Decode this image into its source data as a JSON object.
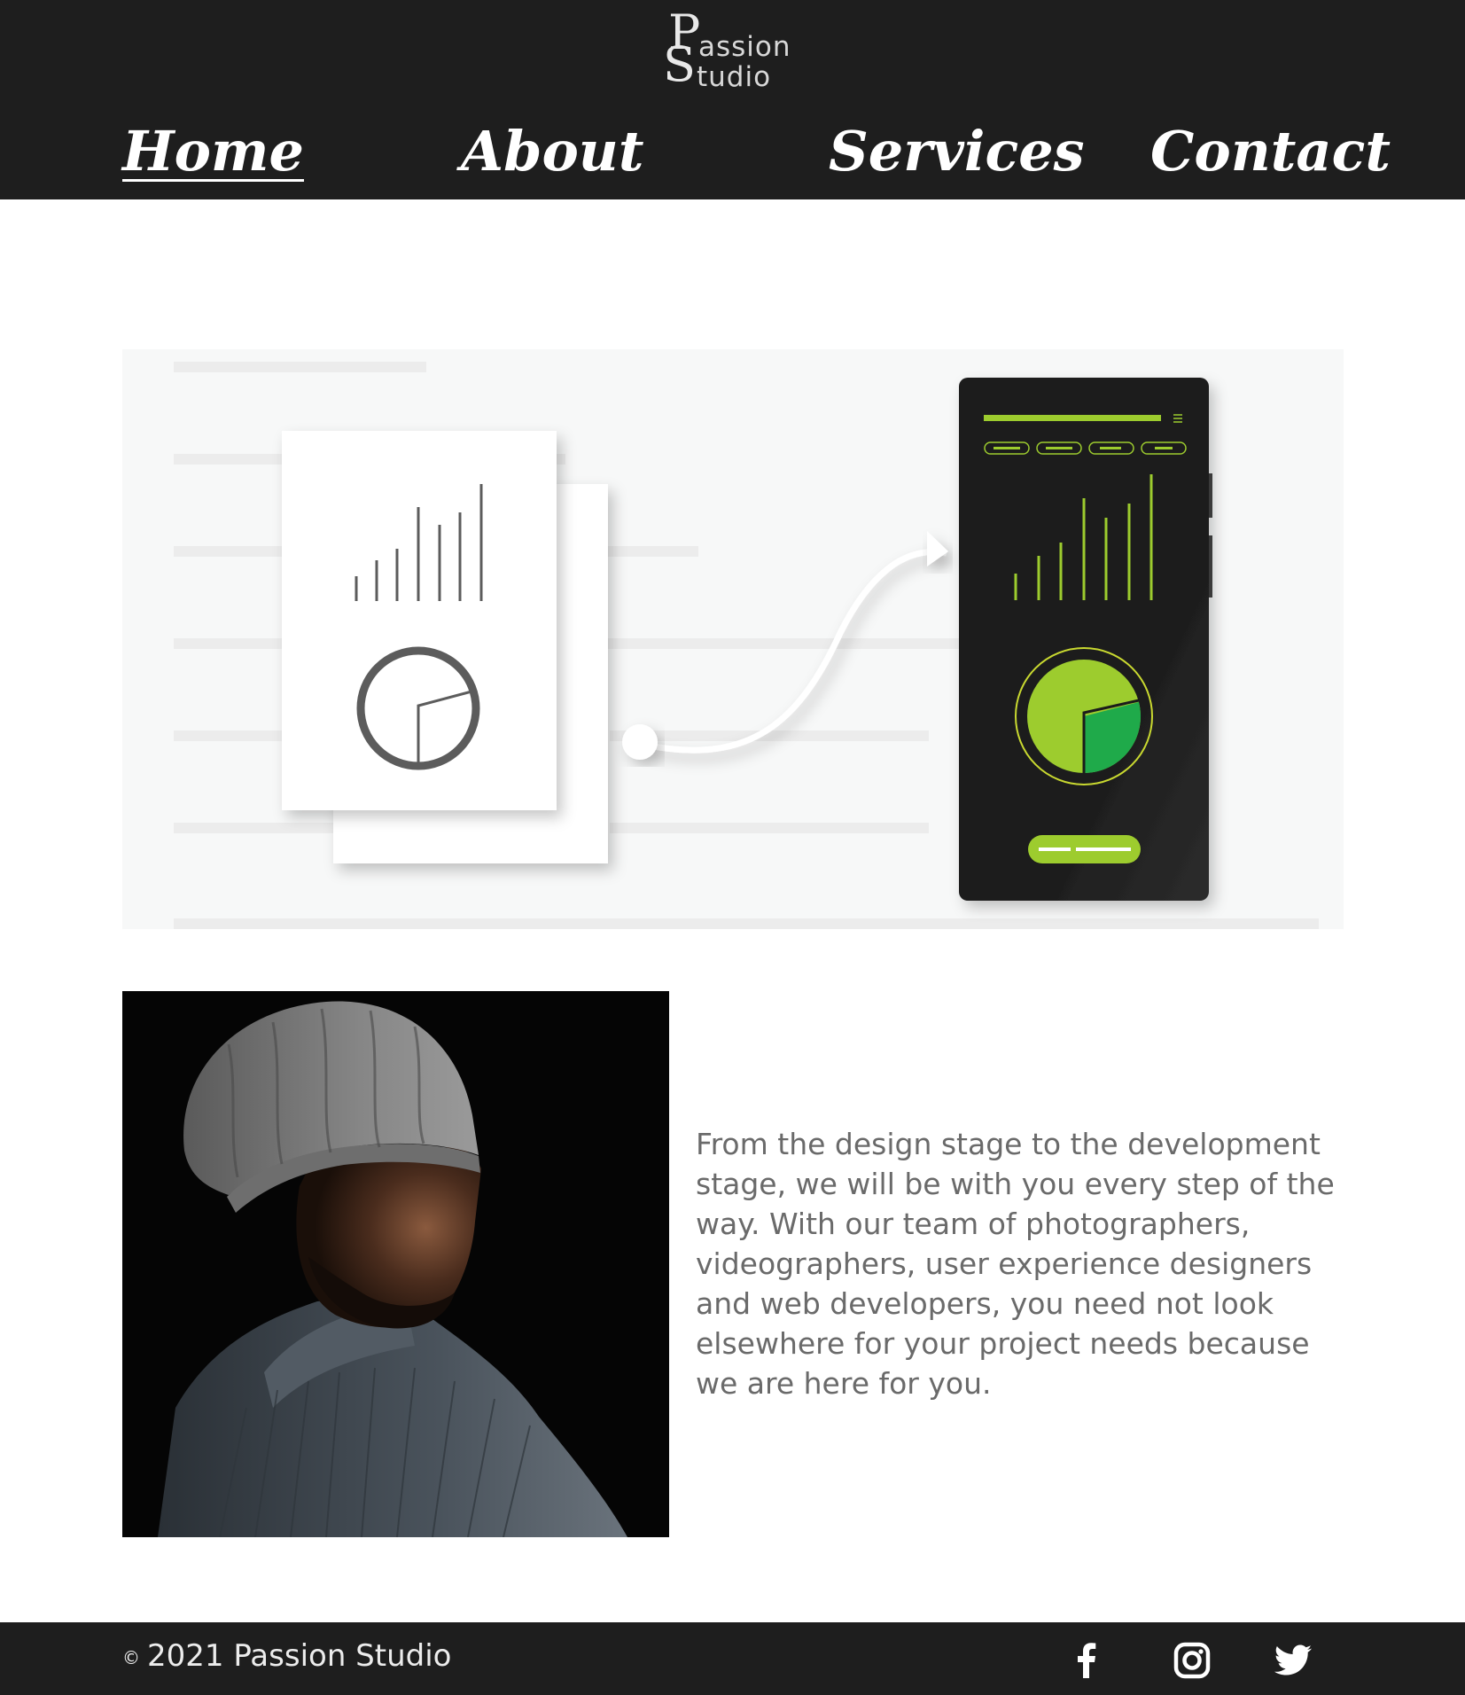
{
  "header": {
    "logo": {
      "line1_initial": "P",
      "line1_rest": "assion",
      "line2_initial": "S",
      "line2_rest": "tudio"
    },
    "nav": [
      {
        "label": "Home",
        "active": true
      },
      {
        "label": "About",
        "active": false
      },
      {
        "label": "Services",
        "active": false
      },
      {
        "label": "Contact",
        "active": false
      }
    ]
  },
  "main": {
    "about_text": "From the design stage to the development stage, we will be with you every step of the way. With our team of photographers, videographers, user experience designers and web developers, you need not look elsewhere for your project needs because we are here for you."
  },
  "footer": {
    "copyright_symbol": "©",
    "copyright_text": "2021 Passion Studio",
    "social": [
      "facebook-icon",
      "instagram-icon",
      "twitter-icon"
    ]
  },
  "colors": {
    "header_bg": "#1e1e1e",
    "accent_green": "#9dcc2e",
    "accent_dark_green": "#1faa4a",
    "text_gray": "#6a6a6a"
  }
}
